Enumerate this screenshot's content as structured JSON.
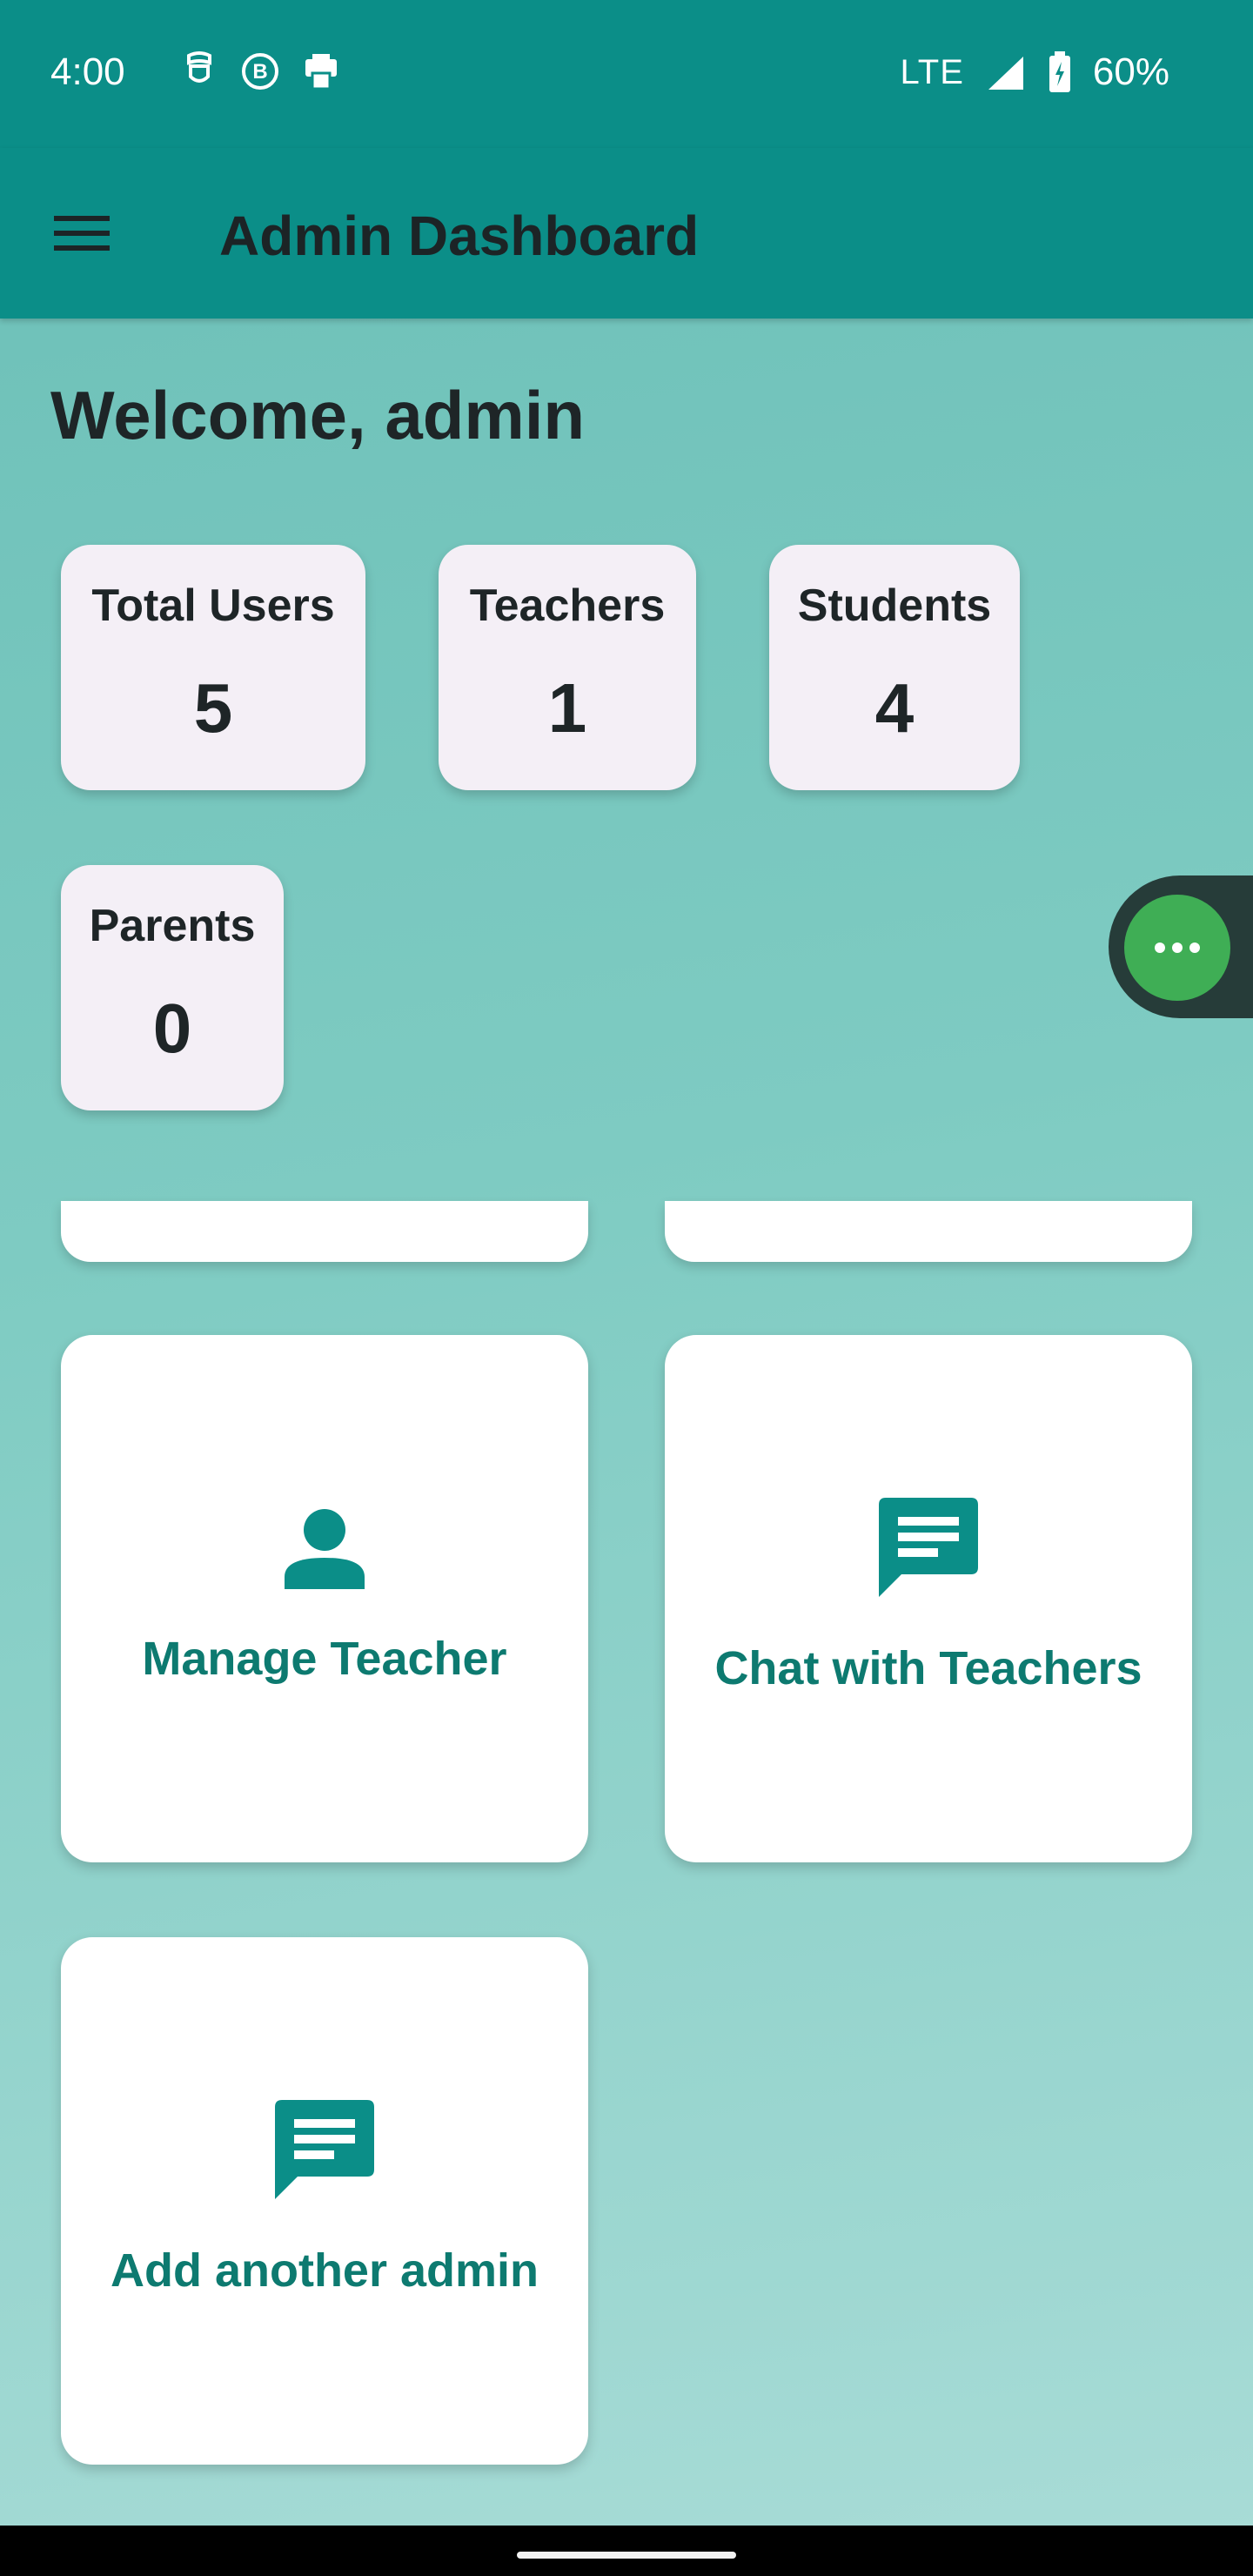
{
  "status_bar": {
    "time": "4:00",
    "network": "LTE",
    "battery": "60%",
    "left_icons": [
      "notification-icon-1",
      "b-icon",
      "print-icon"
    ]
  },
  "app_bar": {
    "title": "Admin Dashboard",
    "menu_icon": "hamburger-menu-icon"
  },
  "welcome": "Welcome, admin",
  "stats": [
    {
      "label": "Total Users",
      "value": "5"
    },
    {
      "label": "Teachers",
      "value": "1"
    },
    {
      "label": "Students",
      "value": "4"
    },
    {
      "label": "Parents",
      "value": "0"
    }
  ],
  "floating_bubble": {
    "icon": "more-dots-icon",
    "text": "•••"
  },
  "actions": [
    {
      "label": "Manage Teacher",
      "icon": "person-icon"
    },
    {
      "label": "Chat with Teachers",
      "icon": "chat-icon"
    },
    {
      "label": "Add another admin",
      "icon": "chat-icon"
    }
  ],
  "colors": {
    "primary": "#0b8e88",
    "accent_text": "#0d7a70",
    "card_bg": "#f4eff6",
    "bubble": "#3fae55"
  }
}
